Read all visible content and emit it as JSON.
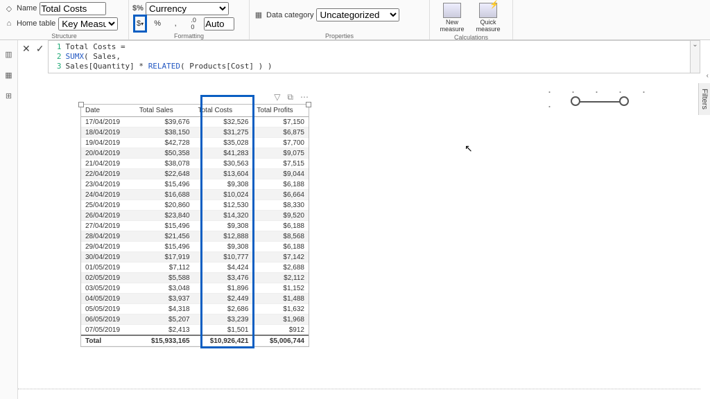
{
  "ribbon": {
    "name_label": "Name",
    "name_value": "Total Costs",
    "home_label": "Home table",
    "home_value": "Key Measures",
    "structure_label": "Structure",
    "format_type": "Currency",
    "symbol": "$",
    "percent": "%",
    "comma": ",",
    "dec_inc": ".0",
    "decimals": "Auto",
    "formatting_label": "Formatting",
    "datacat_label": "Data category",
    "datacat_value": "Uncategorized",
    "properties_label": "Properties",
    "new_measure": "New measure",
    "quick_measure": "Quick measure",
    "calc_label": "Calculations"
  },
  "formula": {
    "l1": "Total Costs =",
    "l2a": "SUMX",
    "l2b": "( Sales,",
    "l3a": "    Sales[Quantity] * ",
    "l3b": "RELATED",
    "l3c": "( Products[Cost] ) )"
  },
  "table": {
    "headers": [
      "Date",
      "Total Sales",
      "Total Costs",
      "Total Profits"
    ],
    "rows": [
      [
        "17/04/2019",
        "$39,676",
        "$32,526",
        "$7,150"
      ],
      [
        "18/04/2019",
        "$38,150",
        "$31,275",
        "$6,875"
      ],
      [
        "19/04/2019",
        "$42,728",
        "$35,028",
        "$7,700"
      ],
      [
        "20/04/2019",
        "$50,358",
        "$41,283",
        "$9,075"
      ],
      [
        "21/04/2019",
        "$38,078",
        "$30,563",
        "$7,515"
      ],
      [
        "22/04/2019",
        "$22,648",
        "$13,604",
        "$9,044"
      ],
      [
        "23/04/2019",
        "$15,496",
        "$9,308",
        "$6,188"
      ],
      [
        "24/04/2019",
        "$16,688",
        "$10,024",
        "$6,664"
      ],
      [
        "25/04/2019",
        "$20,860",
        "$12,530",
        "$8,330"
      ],
      [
        "26/04/2019",
        "$23,840",
        "$14,320",
        "$9,520"
      ],
      [
        "27/04/2019",
        "$15,496",
        "$9,308",
        "$6,188"
      ],
      [
        "28/04/2019",
        "$21,456",
        "$12,888",
        "$8,568"
      ],
      [
        "29/04/2019",
        "$15,496",
        "$9,308",
        "$6,188"
      ],
      [
        "30/04/2019",
        "$17,919",
        "$10,777",
        "$7,142"
      ],
      [
        "01/05/2019",
        "$7,112",
        "$4,424",
        "$2,688"
      ],
      [
        "02/05/2019",
        "$5,588",
        "$3,476",
        "$2,112"
      ],
      [
        "03/05/2019",
        "$3,048",
        "$1,896",
        "$1,152"
      ],
      [
        "04/05/2019",
        "$3,937",
        "$2,449",
        "$1,488"
      ],
      [
        "05/05/2019",
        "$4,318",
        "$2,686",
        "$1,632"
      ],
      [
        "06/05/2019",
        "$5,207",
        "$3,239",
        "$1,968"
      ],
      [
        "07/05/2019",
        "$2,413",
        "$1,501",
        "$912"
      ]
    ],
    "total": [
      "Total",
      "$15,933,165",
      "$10,926,421",
      "$5,006,744"
    ]
  },
  "filters_label": "Filters"
}
